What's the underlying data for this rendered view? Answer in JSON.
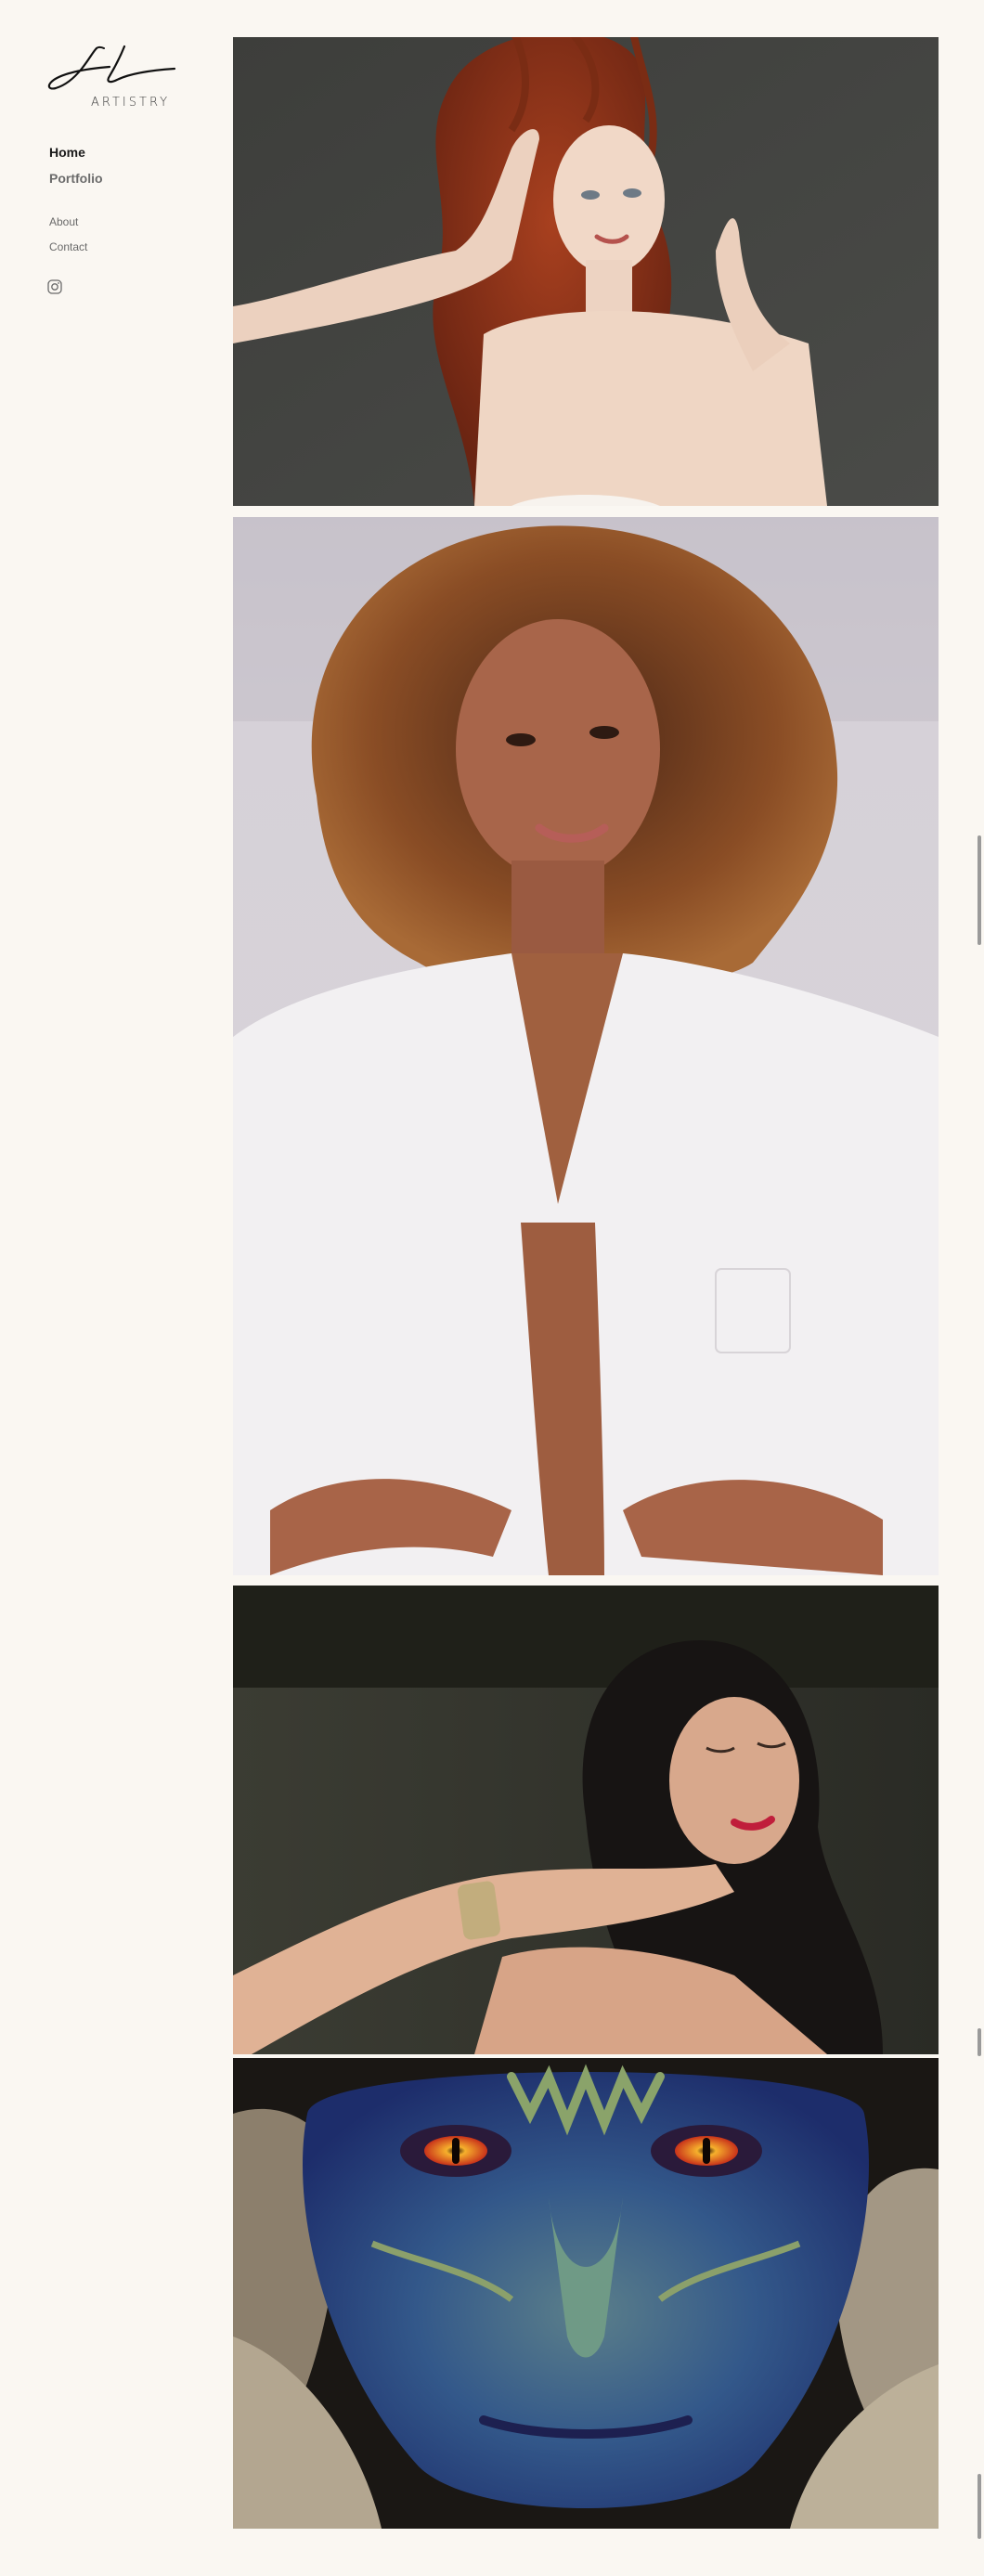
{
  "brand": {
    "wordmark": "ARTISTRY",
    "logo_icon": "jl-monogram-icon"
  },
  "nav": {
    "primary": [
      {
        "label": "Home",
        "active": true
      },
      {
        "label": "Portfolio",
        "active": false
      }
    ],
    "secondary": [
      {
        "label": "About"
      },
      {
        "label": "Contact"
      }
    ],
    "social_icon": "instagram-icon"
  },
  "gallery": {
    "photos": [
      {
        "name": "red-hair-portrait"
      },
      {
        "name": "curly-hair-white-shirt-portrait"
      },
      {
        "name": "dark-hair-red-lips-portrait"
      },
      {
        "name": "reptile-creature-makeup"
      }
    ]
  },
  "colors": {
    "background": "#faf7f2",
    "text_active": "#1a1a1a",
    "text_muted": "#6b6b6b"
  }
}
